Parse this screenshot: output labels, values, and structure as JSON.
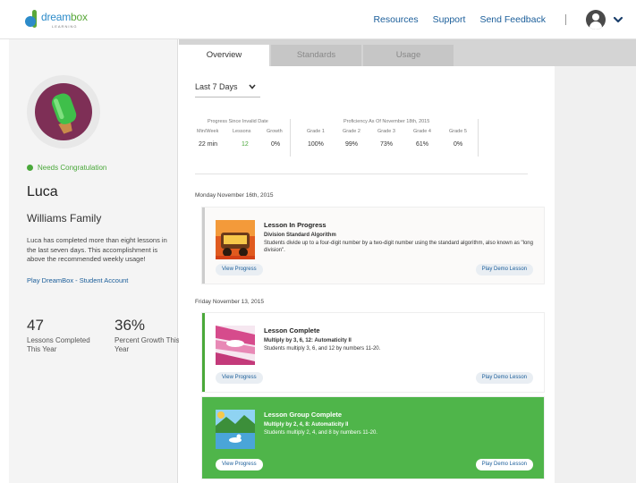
{
  "header": {
    "logo_brand_a": "dream",
    "logo_brand_b": "box",
    "logo_sub": "LEARNING",
    "nav": [
      "Resources",
      "Support",
      "Send Feedback"
    ],
    "nav_separator": "|"
  },
  "student": {
    "status": "Needs Congratulation",
    "name": "Luca",
    "family": "Williams Family",
    "summary": "Luca has completed more than eight lessons in the last seven days. This accomplishment is above the recommended weekly usage!",
    "play_link": "Play DreamBox - Student Account",
    "lessons_completed": "47",
    "lessons_completed_label": "Lessons Completed This Year",
    "percent_growth": "36%",
    "percent_growth_label": "Percent Growth This Year"
  },
  "tabs": [
    "Overview",
    "Standards",
    "Usage"
  ],
  "range": {
    "selected": "Last 7 Days"
  },
  "progress": {
    "title": "Progress Since Invalid Date",
    "cols": [
      {
        "h": "Min/Week",
        "v": "22 min"
      },
      {
        "h": "Lessons",
        "v": "12"
      },
      {
        "h": "Growth",
        "v": "0%"
      }
    ]
  },
  "proficiency": {
    "title": "Proficiency As Of November 18th, 2015",
    "cols": [
      {
        "h": "Grade 1",
        "v": "100%"
      },
      {
        "h": "Grade 2",
        "v": "99%"
      },
      {
        "h": "Grade 3",
        "v": "73%"
      },
      {
        "h": "Grade 4",
        "v": "61%"
      },
      {
        "h": "Grade 5",
        "v": "0%"
      }
    ]
  },
  "days": [
    {
      "date": "Monday November 16th, 2015"
    },
    {
      "date": "Friday November 13, 2015"
    }
  ],
  "cards": [
    {
      "title": "Lesson In Progress",
      "subtitle": "Division Standard Algorithm",
      "desc": "Students divide up to a four-digit number by a two-digit number using the standard algorithm, also known as \"long division\".",
      "view_label": "View Progress",
      "demo_label": "Play Demo Lesson"
    },
    {
      "title": "Lesson Complete",
      "subtitle": "Multiply by 3, 6, 12: Automaticity II",
      "desc": "Students multiply 3, 6, and 12 by numbers 11-20.",
      "view_label": "View Progress",
      "demo_label": "Play Demo Lesson"
    },
    {
      "title": "Lesson Group Complete",
      "subtitle": "Multiply by 2, 4, 8: Automaticity II",
      "desc": "Students multiply 2, 4, and 8 by numbers 11-20.",
      "view_label": "View Progress",
      "demo_label": "Play Demo Lesson"
    }
  ],
  "colors": {
    "accent_green": "#4fb54a",
    "link_blue": "#1b5e9a",
    "badge_purple": "#7e2f56"
  }
}
